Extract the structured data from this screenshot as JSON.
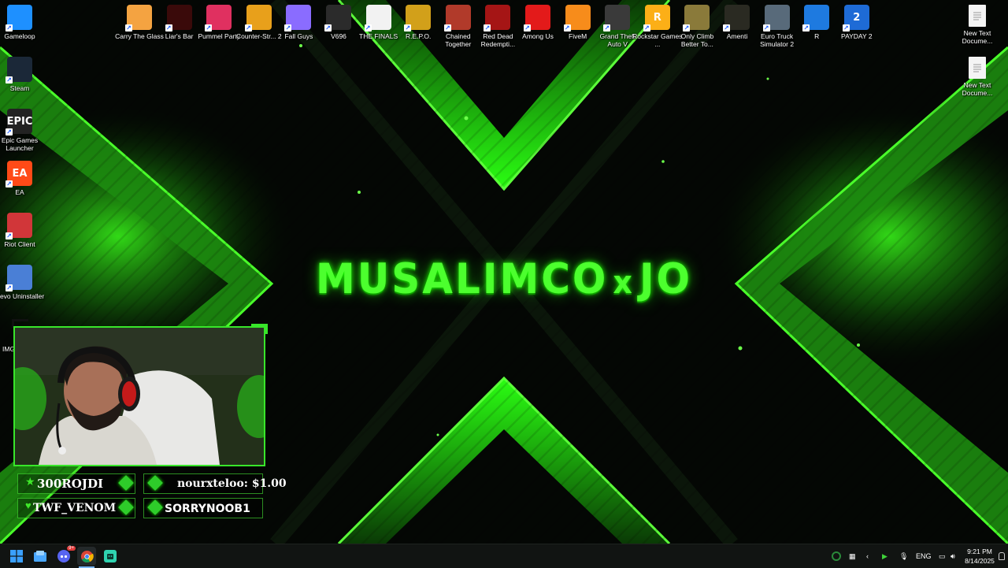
{
  "wallpaper": {
    "logo_text_left": "MUSALIMCO",
    "logo_text_x": "x",
    "logo_text_right": "JO",
    "accent": "#39ff14"
  },
  "desktop_left": [
    {
      "label": "Gameloop",
      "icon": "gameloop-icon",
      "color": "#1e90ff"
    },
    {
      "label": "Steam",
      "icon": "steam-icon",
      "color": "#1b2838"
    },
    {
      "label": "Epic Games Launcher",
      "icon": "epic-games-icon",
      "color": "#222222",
      "glyph": "EPIC"
    },
    {
      "label": "EA",
      "icon": "ea-icon",
      "color": "#ff4a17",
      "glyph": "EA"
    },
    {
      "label": "Riot Client",
      "icon": "riot-client-icon",
      "color": "#d13639"
    },
    {
      "label": "Revo Uninstaller",
      "icon": "revo-uninstaller-icon",
      "color": "#4a7fd6"
    }
  ],
  "desktop_left_partial_label": "IMG",
  "desktop_top": [
    {
      "label": "Carry The Glass",
      "icon": "carry-the-glass-icon",
      "color": "#f4a341"
    },
    {
      "label": "Liar's Bar",
      "icon": "liars-bar-icon",
      "color": "#3a0a0a"
    },
    {
      "label": "Pummel Party",
      "icon": "pummel-party-icon",
      "color": "#e03060"
    },
    {
      "label": "Counter-Str... 2",
      "icon": "counter-strike-icon",
      "color": "#e8a01b"
    },
    {
      "label": "Fall Guys",
      "icon": "fall-guys-icon",
      "color": "#8a6cff"
    },
    {
      "label": "V696",
      "icon": "v696-icon",
      "color": "#2b2b2b"
    },
    {
      "label": "THE FINALS",
      "icon": "the-finals-icon",
      "color": "#f2f2f2"
    },
    {
      "label": "R.E.P.O.",
      "icon": "repo-icon",
      "color": "#d2a01a"
    },
    {
      "label": "Chained Together",
      "icon": "chained-together-icon",
      "color": "#b13a2a"
    },
    {
      "label": "Red Dead Redempti...",
      "icon": "red-dead-icon",
      "color": "#a51515"
    },
    {
      "label": "Among Us",
      "icon": "among-us-icon",
      "color": "#e31a1a"
    },
    {
      "label": "FiveM",
      "icon": "fivem-icon",
      "color": "#f78c1b"
    },
    {
      "label": "Grand Theft Auto V",
      "icon": "gta-v-icon",
      "color": "#3a3a3a"
    },
    {
      "label": "Rockstar Games ...",
      "icon": "rockstar-games-icon",
      "color": "#fcaf17",
      "glyph": "R"
    },
    {
      "label": "Only Climb Better To...",
      "icon": "only-climb-icon",
      "color": "#8a7a3a"
    },
    {
      "label": "Amenti",
      "icon": "amenti-icon",
      "color": "#2a2a22"
    },
    {
      "label": "Euro Truck Simulator 2",
      "icon": "euro-truck-icon",
      "color": "#586a7a"
    },
    {
      "label": "R",
      "icon": "rocket-league-icon",
      "color": "#1e7ae0"
    },
    {
      "label": "PAYDAY 2",
      "icon": "payday-2-icon",
      "color": "#1e6bd6",
      "glyph": "2"
    }
  ],
  "desktop_right": [
    {
      "label": "New Text Docume...",
      "icon": "text-document-icon"
    },
    {
      "label": "New Text Docume...",
      "icon": "text-document-icon"
    }
  ],
  "overlay": {
    "sub_1": "300ROJDI",
    "sub_2": "TWF_VENOM",
    "donation": "nourxteloo: $1.00",
    "follower": "SORRYNOOB1"
  },
  "taskbar": {
    "apps": [
      {
        "icon": "windows-start-icon"
      },
      {
        "icon": "file-explorer-icon"
      },
      {
        "icon": "discord-icon",
        "badge": "9+"
      },
      {
        "icon": "chrome-icon"
      },
      {
        "icon": "android-app-icon"
      }
    ],
    "language": "ENG",
    "time": "9:21 PM",
    "date": "8/14/2025"
  }
}
